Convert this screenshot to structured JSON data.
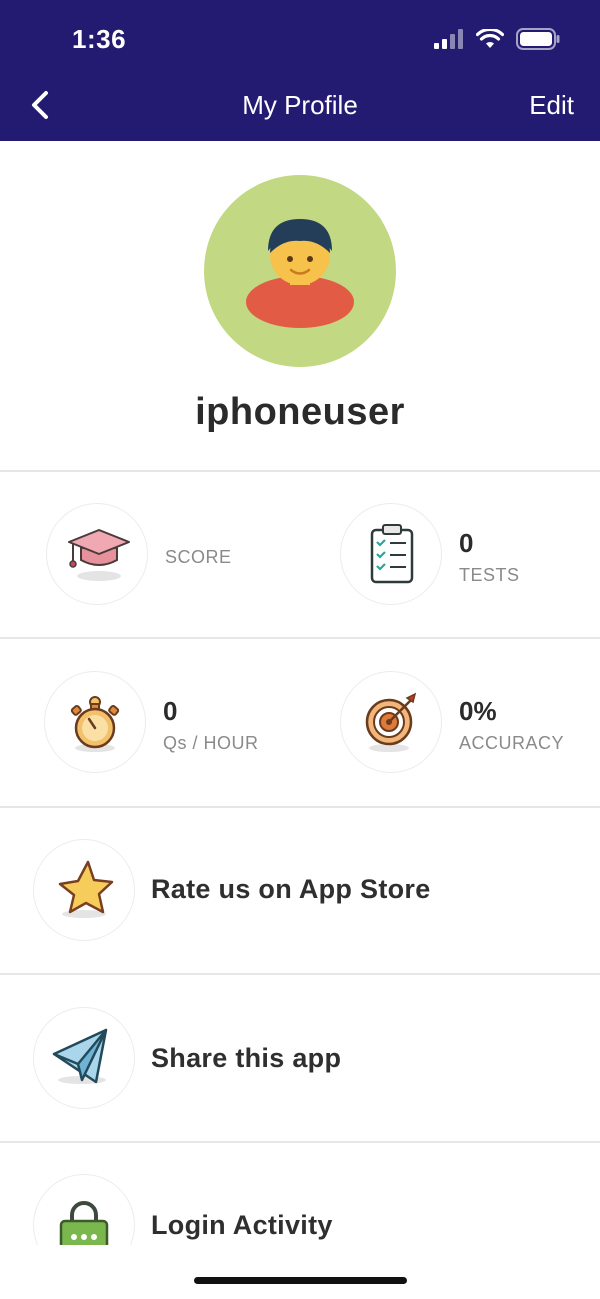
{
  "status_bar": {
    "time": "1:36"
  },
  "nav": {
    "title": "My Profile",
    "edit_label": "Edit"
  },
  "profile": {
    "username": "iphoneuser"
  },
  "stats": {
    "score": {
      "label": "SCORE"
    },
    "tests": {
      "value": "0",
      "label": "TESTS"
    },
    "qs_per_hour": {
      "value": "0",
      "label": "Qs / HOUR"
    },
    "accuracy": {
      "value": "0%",
      "label": "ACCURACY"
    }
  },
  "menu": {
    "rate": {
      "label": "Rate us on App Store",
      "icon": "star-icon"
    },
    "share": {
      "label": "Share this app",
      "icon": "paper-plane-icon"
    },
    "login": {
      "label": "Login Activity",
      "icon": "lock-icon"
    }
  },
  "colors": {
    "header_bg": "#231b72",
    "avatar_bg": "#c2d882"
  }
}
